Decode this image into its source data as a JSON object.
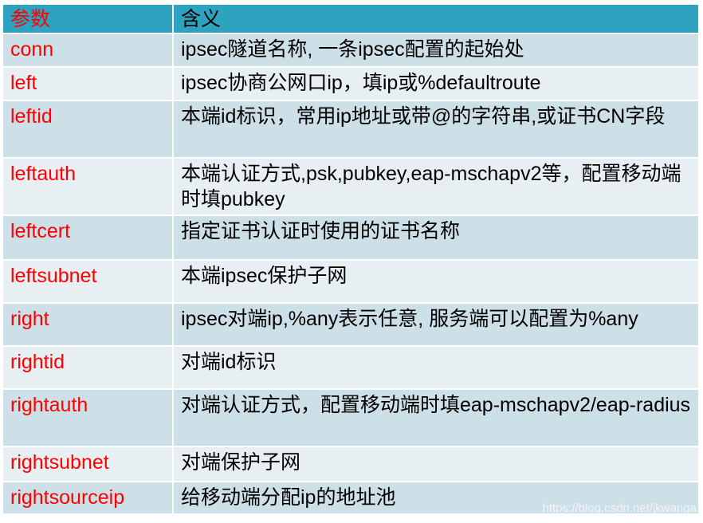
{
  "header": {
    "param": "参数",
    "meaning": "含义"
  },
  "rows": [
    {
      "param": "conn",
      "meaning": "ipsec隧道名称, 一条ipsec配置的起始处"
    },
    {
      "param": "left",
      "meaning": "ipsec协商公网口ip，填ip或%defaultroute"
    },
    {
      "param": "leftid",
      "meaning": "本端id标识，常用ip地址或带@的字符串,或证书CN字段"
    },
    {
      "param": "leftauth",
      "meaning": "本端认证方式,psk,pubkey,eap-mschapv2等，配置移动端时填pubkey"
    },
    {
      "param": "leftcert",
      "meaning": "指定证书认证时使用的证书名称"
    },
    {
      "param": "leftsubnet",
      "meaning": "本端ipsec保护子网"
    },
    {
      "param": "right",
      "meaning": "ipsec对端ip,%any表示任意, 服务端可以配置为%any"
    },
    {
      "param": "rightid",
      "meaning": "对端id标识"
    },
    {
      "param": "rightauth",
      "meaning": "对端认证方式，配置移动端时填eap-mschapv2/eap-radius"
    },
    {
      "param": "rightsubnet",
      "meaning": "对端保护子网"
    },
    {
      "param": "rightsourceip",
      "meaning": "给移动端分配ip的地址池"
    }
  ],
  "watermark": "https://blog.csdn.net/jkwanga",
  "colors": {
    "header": "#2da3c0",
    "row_dark": "#cddfe7",
    "row_light": "#e8eff3",
    "param_text": "#ff0000"
  }
}
